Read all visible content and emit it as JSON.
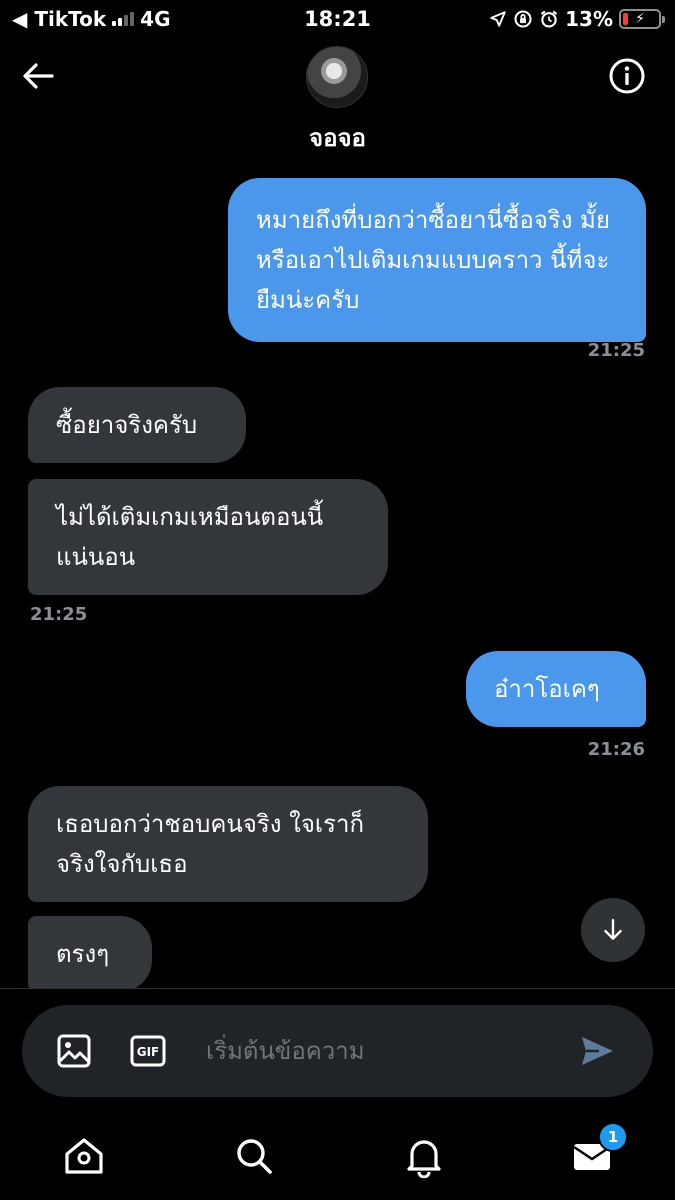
{
  "status_bar": {
    "back_app": "◀ TikTok",
    "network": "4G",
    "time": "18:21",
    "battery_percent": "13%",
    "battery_level": 0.13,
    "battery_color": "#ff3b30",
    "icons": [
      "location-icon",
      "orientation-lock-icon",
      "alarm-icon"
    ]
  },
  "header": {
    "contact_name": "จอจอ",
    "back_icon": "arrow-left-icon",
    "info_icon": "info-icon"
  },
  "messages": [
    {
      "side": "sent",
      "text": "หมายถึงที่บอกว่าซื้อยานี่ซื้อจริง มั้ยหรือเอาไปเติมเกมแบบคราว นี้ที่จะยืมน่ะครับ"
    },
    {
      "side": "sent_time",
      "text": "21:25"
    },
    {
      "side": "recv",
      "text": "ซื้อยาจริงครับ"
    },
    {
      "side": "recv",
      "text": "ไม่ได้เติมเกมเหมือนตอนนี้ แน่นอน"
    },
    {
      "side": "recv_time",
      "text": "21:25"
    },
    {
      "side": "sent",
      "text": "อ๋าาโอเคๆ"
    },
    {
      "side": "sent_time",
      "text": "21:26"
    },
    {
      "side": "recv",
      "text": "เธอบอกว่าชอบคนจริง ใจเราก็ จริงใจกับเธอ"
    },
    {
      "side": "recv",
      "text": "ตรงๆ"
    }
  ],
  "composer": {
    "placeholder": "เริ่มต้นข้อความ",
    "value": "",
    "gif_label": "GIF"
  },
  "nav": {
    "messages_badge": "1"
  },
  "colors": {
    "sent_bubble": "#4a97eb",
    "recv_bubble": "#33373c",
    "accent": "#1d9bf0"
  }
}
